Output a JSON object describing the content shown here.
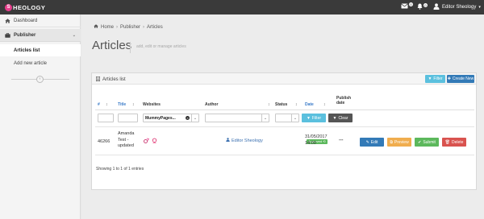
{
  "topbar": {
    "logo_letter": "S",
    "logo_text": "HEOLOGY",
    "messages_count": "0",
    "notifications_count": "0",
    "user_name": "Editor Sheology"
  },
  "sidebar": {
    "dashboard": "Dashboard",
    "publisher": "Publisher",
    "articles_list": "Articles list",
    "add_new_article": "Add new article"
  },
  "breadcrumb": [
    "Home",
    "Publisher",
    "Articles"
  ],
  "page": {
    "title": "Articles",
    "subtitle": "add, edit or manage articles"
  },
  "panel": {
    "title": "Articles list",
    "filter_label": "Filter",
    "create_label": "Create New"
  },
  "table": {
    "headers": {
      "id": "#",
      "title": "Title",
      "websites": "Websites",
      "author": "Author",
      "status": "Status",
      "date": "Date",
      "publish_date_line1": "Publish",
      "publish_date_line2": "date"
    },
    "filters": {
      "websites_value": "MummyPages...",
      "filter_label": "Filter",
      "clear_label": "Clear"
    },
    "row": {
      "id": "46266",
      "title_line1": "Amanda",
      "title_line2": "Test -",
      "title_line3": "updated",
      "author": "Editor Sheology",
      "status": "Approved",
      "date_line1": "31/05/2017",
      "date_line2": "14:00",
      "publish_date": "---",
      "edit_label": "Edit",
      "preview_label": "Preview",
      "submit_label": "Submit",
      "delete_label": "Delete"
    },
    "footer": "Showing 1 to 1 of 1 entries"
  },
  "colors": {
    "topbar": "#3a3a3a",
    "brand": "#e83e8c",
    "primary": "#337ab7",
    "info": "#5bc0de",
    "warning": "#f0ad4e",
    "success": "#5cb85c",
    "danger": "#d9534f"
  }
}
